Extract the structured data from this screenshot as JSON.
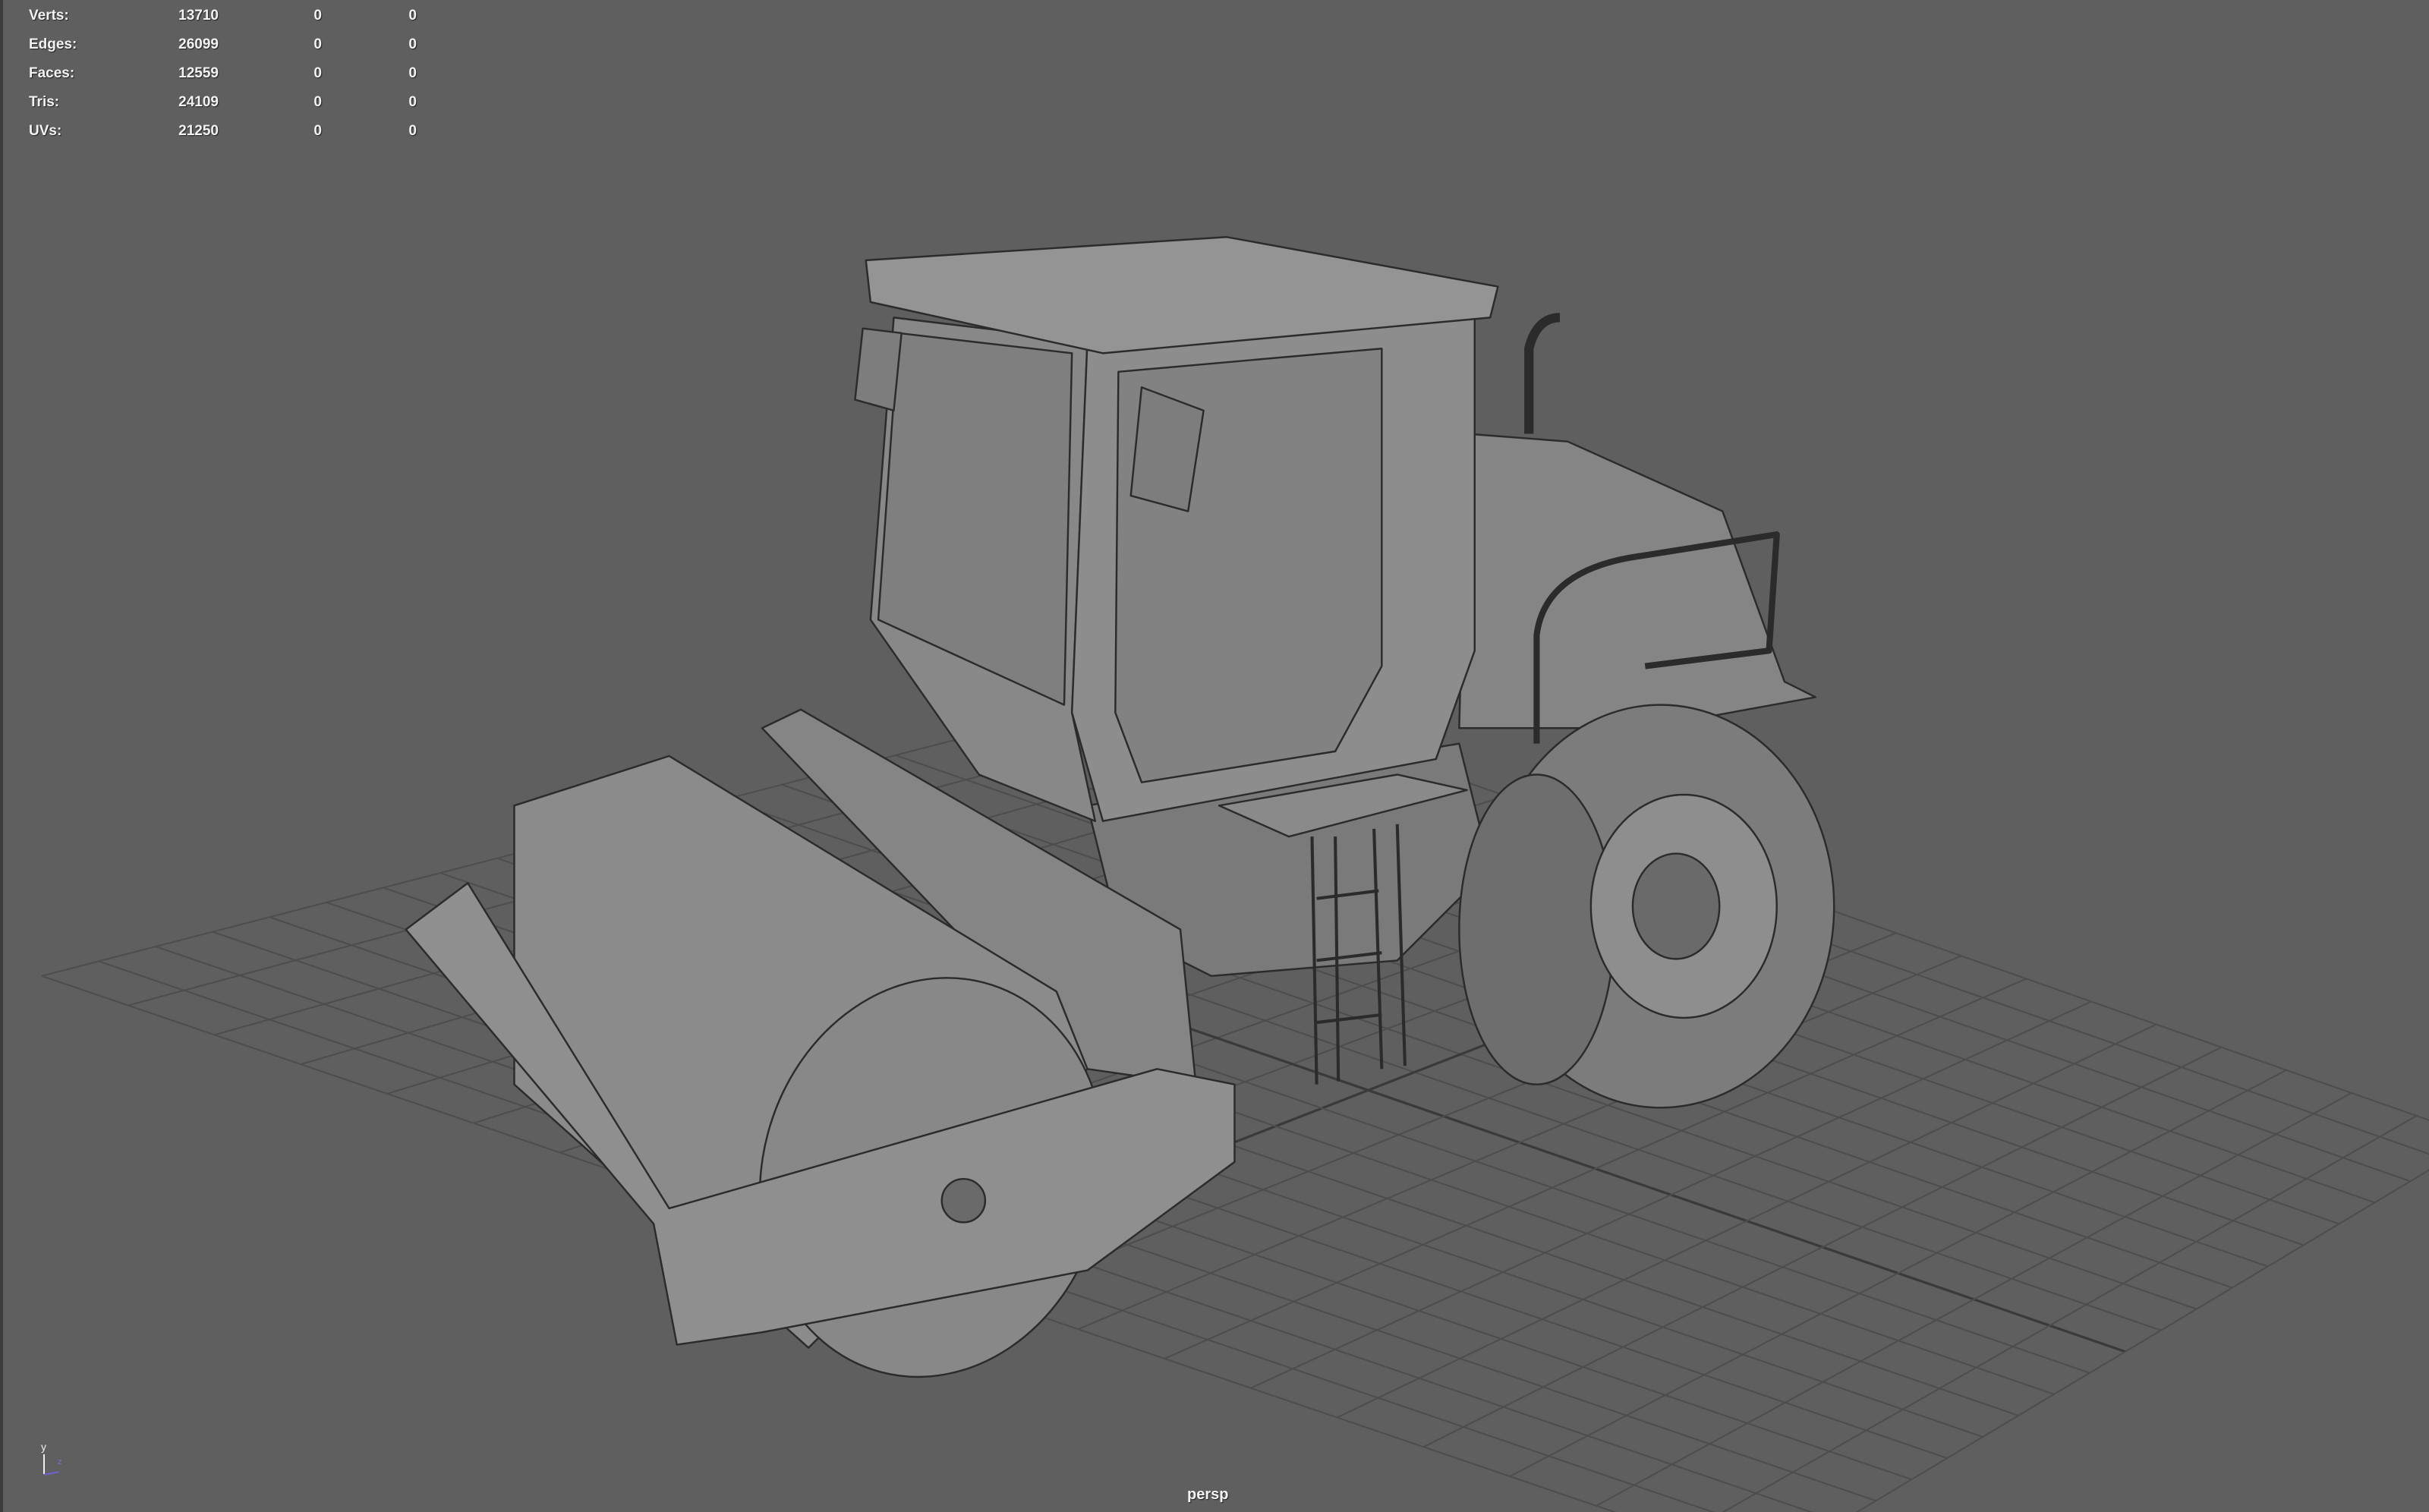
{
  "hud": {
    "rows": [
      {
        "label": "Verts:",
        "values": [
          "13710",
          "0",
          "0"
        ]
      },
      {
        "label": "Edges:",
        "values": [
          "26099",
          "0",
          "0"
        ]
      },
      {
        "label": "Faces:",
        "values": [
          "12559",
          "0",
          "0"
        ]
      },
      {
        "label": "Tris:",
        "values": [
          "24109",
          "0",
          "0"
        ]
      },
      {
        "label": "UVs:",
        "values": [
          "21250",
          "0",
          "0"
        ]
      }
    ]
  },
  "camera": {
    "label": "persp"
  },
  "axis": {
    "y": "y",
    "z": "z"
  },
  "colors": {
    "background": "#5f5f5f",
    "grid": "#4a4a4a",
    "mesh_fill": "#8a8a8a",
    "wire": "#2a2a2a"
  }
}
